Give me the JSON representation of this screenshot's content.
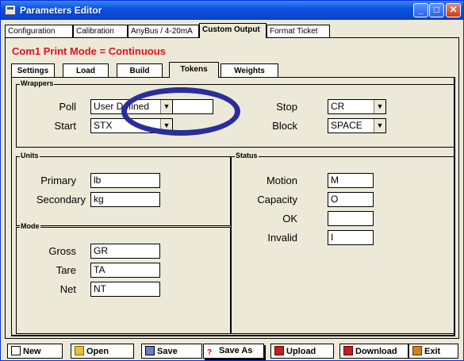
{
  "window": {
    "title": "Parameters Editor"
  },
  "main_tabs": [
    {
      "label": "Configuration",
      "active": false
    },
    {
      "label": "Calibration",
      "active": false
    },
    {
      "label": "AnyBus / 4-20mA",
      "active": false
    },
    {
      "label": "Custom Output",
      "active": true
    },
    {
      "label": "Format Ticket",
      "active": false
    }
  ],
  "mode_title": "Com1 Print Mode = Continuous",
  "sub_tabs": [
    {
      "label": "Settings",
      "active": false
    },
    {
      "label": "Load",
      "active": false
    },
    {
      "label": "Build",
      "active": false
    },
    {
      "label": "Tokens",
      "active": true
    },
    {
      "label": "Weights",
      "active": false
    }
  ],
  "wrappers": {
    "group_label": "Wrappers",
    "poll": {
      "label": "Poll",
      "value": "User Defined",
      "custom": ""
    },
    "start": {
      "label": "Start",
      "value": "STX"
    },
    "stop": {
      "label": "Stop",
      "value": "CR"
    },
    "block": {
      "label": "Block",
      "value": "SPACE"
    }
  },
  "units": {
    "group_label": "Units",
    "primary": {
      "label": "Primary",
      "value": "lb"
    },
    "secondary": {
      "label": "Secondary",
      "value": "kg"
    }
  },
  "mode": {
    "group_label": "Mode",
    "gross": {
      "label": "Gross",
      "value": "GR"
    },
    "tare": {
      "label": "Tare",
      "value": "TA"
    },
    "net": {
      "label": "Net",
      "value": "NT"
    }
  },
  "status": {
    "group_label": "Status",
    "motion": {
      "label": "Motion",
      "value": "M"
    },
    "capacity": {
      "label": "Capacity",
      "value": "O"
    },
    "ok": {
      "label": "OK",
      "value": ""
    },
    "invalid": {
      "label": "Invalid",
      "value": "I"
    }
  },
  "toolbar": {
    "new": "New",
    "open": "Open",
    "save": "Save",
    "save_as": "Save As",
    "upload": "Upload",
    "download": "Download",
    "exit": "Exit"
  },
  "icons": {
    "app": "window-app-icon",
    "minimize": "minimize-icon",
    "maximize": "maximize-icon",
    "close": "close-icon"
  },
  "colors": {
    "titlebar": "#0a54e0",
    "mode_title": "#e8101a",
    "annotation_ellipse": "#2a2d9a",
    "window_bg": "#ece9d8"
  }
}
